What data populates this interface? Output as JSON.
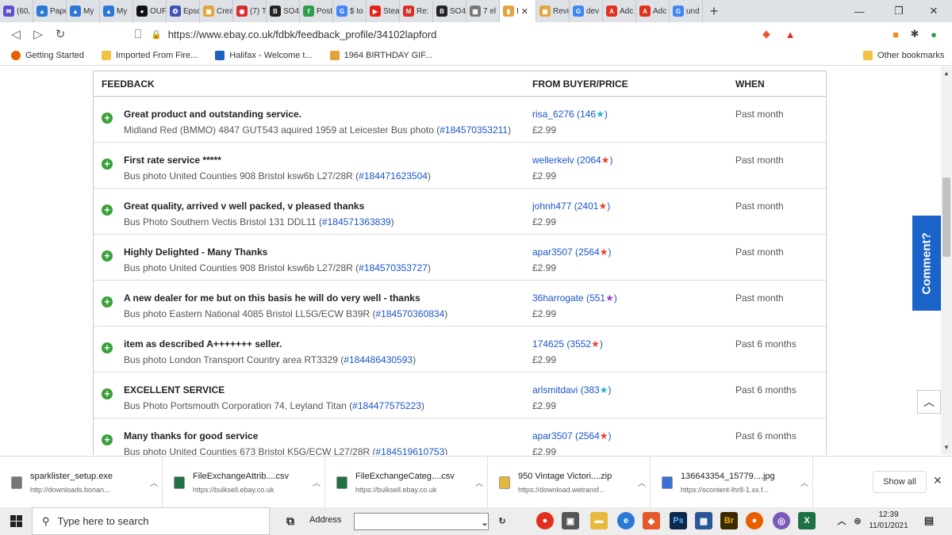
{
  "tabs": [
    {
      "label": "(60,",
      "color": "#5a4fcf",
      "glyph": "✉"
    },
    {
      "label": "Pape",
      "color": "#2b79d4",
      "glyph": "▲"
    },
    {
      "label": "My",
      "color": "#2b79d4",
      "glyph": "▲"
    },
    {
      "label": "My",
      "color": "#2b79d4",
      "glyph": "▲"
    },
    {
      "label": "OUF",
      "color": "#111111",
      "glyph": "●"
    },
    {
      "label": "Epsc",
      "color": "#3f51b5",
      "glyph": "✪"
    },
    {
      "label": "Crea",
      "color": "#e2a33a",
      "glyph": "▣"
    },
    {
      "label": "(7) T",
      "color": "#d32f2f",
      "glyph": "◉"
    },
    {
      "label": "SO4",
      "color": "#222222",
      "glyph": "B"
    },
    {
      "label": "Post",
      "color": "#2e9e4b",
      "glyph": "f"
    },
    {
      "label": "$ to",
      "color": "#4285f4",
      "glyph": "G"
    },
    {
      "label": "Stea",
      "color": "#e62117",
      "glyph": "▶"
    },
    {
      "label": "Re:",
      "color": "#d93025",
      "glyph": "M"
    },
    {
      "label": "SO4",
      "color": "#222222",
      "glyph": "B"
    },
    {
      "label": "7 el",
      "color": "#777777",
      "glyph": "▦"
    },
    {
      "label": "I",
      "color": "#e2a33a",
      "glyph": "▮",
      "active": true
    },
    {
      "label": "Revi",
      "color": "#e2a33a",
      "glyph": "▣"
    },
    {
      "label": "dev",
      "color": "#4285f4",
      "glyph": "G"
    },
    {
      "label": "Adc",
      "color": "#e0301e",
      "glyph": "A"
    },
    {
      "label": "Adc",
      "color": "#e0301e",
      "glyph": "A"
    },
    {
      "label": "und",
      "color": "#4285f4",
      "glyph": "G"
    }
  ],
  "url": "https://www.ebay.co.uk/fdbk/feedback_profile/34102lapford",
  "bookmarks": [
    {
      "label": "Getting Started",
      "type": "firefox"
    },
    {
      "label": "Imported From Fire...",
      "type": "folder"
    },
    {
      "label": "Halifax - Welcome t...",
      "type": "halifax"
    },
    {
      "label": "1964 BIRTHDAY GIF...",
      "type": "gift"
    }
  ],
  "other_bookmarks": "Other bookmarks",
  "table_headers": {
    "feedback": "FEEDBACK",
    "buyer": "FROM BUYER/PRICE",
    "when": "WHEN"
  },
  "feedback": [
    {
      "comment": "Great product and outstanding service.",
      "item": "Midland Red (BMMO) 4847 GUT543 aquired 1959 at Leicester Bus photo (",
      "item_no": "#184570353211",
      "buyer": "risa_6276",
      "score": "146",
      "star_color": "#20b2d6",
      "price": "£2.99",
      "when": "Past month"
    },
    {
      "comment": "First rate service *****",
      "item": "Bus photo United Counties 908 Bristol ksw6b L27/28R (",
      "item_no": "#184471623504",
      "buyer": "wellerkelv",
      "score": "2064",
      "star_color": "#e8402a",
      "price": "£2.99",
      "when": "Past month"
    },
    {
      "comment": "Great quality, arrived v well packed, v pleased thanks",
      "item": "Bus Photo Southern Vectis Bristol 131 DDL11 (",
      "item_no": "#184571363839",
      "buyer": "johnh477",
      "score": "2401",
      "star_color": "#e8402a",
      "price": "£2.99",
      "when": "Past month"
    },
    {
      "comment": "Highly Delighted - Many Thanks",
      "item": "Bus photo United Counties 908 Bristol ksw6b L27/28R (",
      "item_no": "#184570353727",
      "buyer": "apar3507",
      "score": "2564",
      "star_color": "#e8402a",
      "price": "£2.99",
      "when": "Past month"
    },
    {
      "comment": "A new dealer for me but on this basis he will do very well - thanks",
      "item": "Bus photo Eastern National 4085 Bristol LL5G/ECW B39R (",
      "item_no": "#184570360834",
      "buyer": "36harrogate",
      "score": "551",
      "star_color": "#9b3fd0",
      "price": "£2.99",
      "when": "Past month"
    },
    {
      "comment": "item as described A+++++++ seller.",
      "item": "Bus photo London Transport Country area RT3329 (",
      "item_no": "#184486430593",
      "buyer": "174625",
      "score": "3552",
      "star_color": "#e8402a",
      "price": "£2.99",
      "when": "Past 6 months"
    },
    {
      "comment": "EXCELLENT SERVICE",
      "item": "Bus Photo Portsmouth Corporation 74, Leyland Titan (",
      "item_no": "#184477575223",
      "buyer": "arlsmitdavi",
      "score": "383",
      "star_color": "#20b2d6",
      "price": "£2.99",
      "when": "Past 6 months"
    },
    {
      "comment": "Many thanks for good service",
      "item": "Bus photo United Counties 673 Bristol K5G/ECW L27/28R (",
      "item_no": "#184519610753",
      "buyer": "apar3507",
      "score": "2564",
      "star_color": "#e8402a",
      "price": "£2.99",
      "when": "Past 6 months"
    }
  ],
  "comment_button": "Comment?",
  "downloads": [
    {
      "name": "sparklister_setup.exe",
      "url": "http://downloads.bonan...",
      "icon_color": "#777777"
    },
    {
      "name": "FileExchangeAttrib....csv",
      "url": "https://bulksell.ebay.co.uk",
      "icon_color": "#1e7145"
    },
    {
      "name": "FileExchangeCateg....csv",
      "url": "https://bulksell.ebay.co.uk",
      "icon_color": "#1e7145"
    },
    {
      "name": "950 Vintage Victori....zip",
      "url": "https://download.wetransf...",
      "icon_color": "#e2b93a"
    },
    {
      "name": "136643354_15779....jpg",
      "url": "https://scontent-lhr8-1.xx.f...",
      "icon_color": "#3b6fd3"
    }
  ],
  "show_all": "Show all",
  "taskbar": {
    "search_placeholder": "Type here to search",
    "address_label": "Address",
    "time": "12:39",
    "date": "11/01/2021"
  }
}
